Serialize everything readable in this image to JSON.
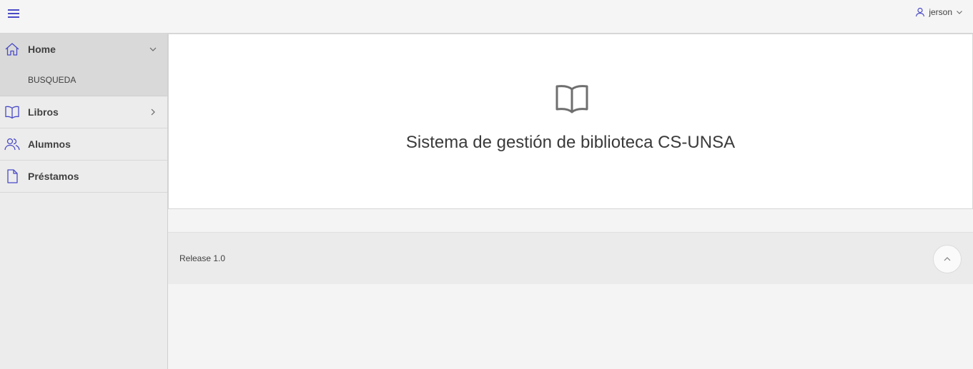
{
  "header": {
    "menu_icon": "hamburger-icon",
    "user": {
      "name": "jerson",
      "icon": "user-icon",
      "dropdown_icon": "chevron-down-icon"
    }
  },
  "sidebar": {
    "items": [
      {
        "label": "Home",
        "icon": "home-icon",
        "expanded": true,
        "children": [
          {
            "label": "BUSQUEDA"
          }
        ]
      },
      {
        "label": "Libros",
        "icon": "book-icon",
        "has_children": true
      },
      {
        "label": "Alumnos",
        "icon": "users-icon"
      },
      {
        "label": "Préstamos",
        "icon": "document-icon"
      }
    ]
  },
  "main": {
    "hero_icon": "book-open-icon",
    "hero_title": "Sistema de gestión de biblioteca CS-UNSA"
  },
  "footer": {
    "release": "Release 1.0",
    "scroll_top_icon": "chevron-up-icon"
  },
  "colors": {
    "accent": "#4a4ac7",
    "topbar_bg": "#f5f5f5",
    "sidebar_bg": "#ececec",
    "active_bg": "#d9d9d9"
  }
}
